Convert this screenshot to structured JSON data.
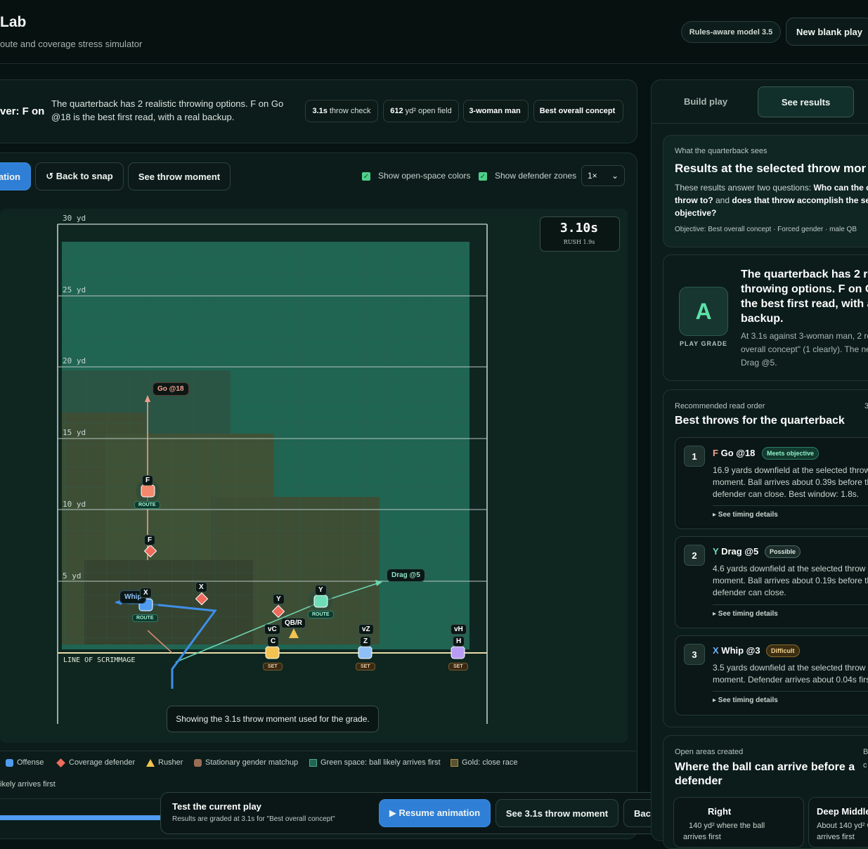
{
  "header": {
    "title": "Lab",
    "subtitle": "oute and coverage stress simulator",
    "model_pill": "Rules-aware model 3.5",
    "new_play": "New blank play"
  },
  "summary": {
    "answer": "ver: F on",
    "text": "The quarterback has 2 realistic throwing options. F on Go @18 is the best first read, with a real backup.",
    "stats": [
      {
        "value": "3.1s",
        "label": "throw check"
      },
      {
        "value": "612",
        "label": "yd² open field"
      },
      {
        "value": "3-woman man",
        "label": ""
      },
      {
        "value": "Best overall concept",
        "label": ""
      }
    ]
  },
  "toolbar": {
    "play_partial": "ation",
    "back_to_snap": "↺ Back to snap",
    "see_throw": "See throw moment",
    "show_open_space": "Show open-space colors",
    "show_zones": "Show defender zones",
    "speed": "1×"
  },
  "field": {
    "clock": "3.10s",
    "rush": "RUSH 1.9s",
    "yard_lines": [
      "30 yd",
      "25 yd",
      "20 yd",
      "15 yd",
      "10 yd",
      "5 yd"
    ],
    "los": "LINE OF SCRIMMAGE",
    "caption": "Showing the 3.1s throw moment used for the grade.",
    "routes": {
      "go": "Go @18",
      "drag": "Drag @5",
      "whip": "Whip"
    },
    "players": {
      "f": "F",
      "f_def": "F",
      "x": "X",
      "x_def": "X",
      "y": "Y",
      "y_def": "Y",
      "qb": "QB/R",
      "c": "C",
      "vc": "vC",
      "z": "Z",
      "vz": "vZ",
      "h": "H",
      "vh": "vH",
      "route": "ROUTE",
      "set": "SET"
    }
  },
  "legend": {
    "offense": "Offense",
    "coverage": "Coverage defender",
    "rusher": "Rusher",
    "stationary": "Stationary gender matchup",
    "green": "Green space: ball likely arrives first",
    "gold": "Gold: close race",
    "red_partial": "ikely arrives first"
  },
  "bottom": {
    "title": "Test the current play",
    "sub": "Results are graded at 3.1s for \"Best overall concept\"",
    "resume": "▶ Resume animation",
    "see_throw": "See 3.1s throw moment",
    "back": "Back to snap",
    "progress": 0.24
  },
  "right": {
    "tabs": {
      "build": "Build play",
      "results": "See results"
    },
    "sees_cap": "What the quarterback sees",
    "sees_title": "Results at the selected throw mor",
    "sees_body_1": "These results answer two questions: ",
    "sees_bold_1": "Who can the c",
    "sees_body_2": "throw to?",
    "sees_body_3": " and ",
    "sees_bold_2": "does that throw accomplish the se",
    "sees_body_4": "objective?",
    "sees_meta": "Objective: Best overall concept · Forced gender · male QB",
    "grade": "A",
    "grade_label": "PLAY GRADE",
    "grade_headline_lines": [
      "The quarterback has 2 r",
      "throwing options. F on G",
      "the best first read, with a",
      "backup."
    ],
    "grade_detail_lines": [
      "At 3.1s against 3-woman man, 2 re",
      "overall concept\" (1 clearly). The ne",
      "Drag @5."
    ],
    "reads_cap": "Recommended read order",
    "reads_count": "3",
    "reads_title": "Best throws for the quarterback",
    "reads": [
      {
        "num": "1",
        "letter": "F",
        "route": "Go @18",
        "badge": "Meets objective",
        "lines": [
          "16.9 yards downfield at the selected throw",
          "moment. Ball arrives about 0.39s before th",
          "defender can close. Best window: 1.8s."
        ],
        "timing": "▸ See timing details"
      },
      {
        "num": "2",
        "letter": "Y",
        "route": "Drag @5",
        "badge": "Possible",
        "lines": [
          "4.6 yards downfield at the selected throw",
          "moment. Ball arrives about 0.19s before th",
          "defender can close."
        ],
        "timing": "▸ See timing details"
      },
      {
        "num": "3",
        "letter": "X",
        "route": "Whip @3",
        "badge": "Difficult",
        "lines": [
          "3.5 yards downfield at the selected throw",
          "moment. Defender arrives about 0.04s first"
        ],
        "timing": "▸ See timing details"
      }
    ],
    "open_cap": "Open areas created",
    "open_cap_right": "B",
    "open_cap_right2": "c",
    "open_title_lines": [
      "Where the ball can arrive before a",
      "defender"
    ],
    "areas": [
      {
        "name": "Right",
        "lines": [
          "140 yd² where the ball",
          "arrives first"
        ]
      },
      {
        "name": "Deep Middle",
        "lines": [
          "About 140 yd² w",
          "arrives first"
        ]
      }
    ]
  }
}
